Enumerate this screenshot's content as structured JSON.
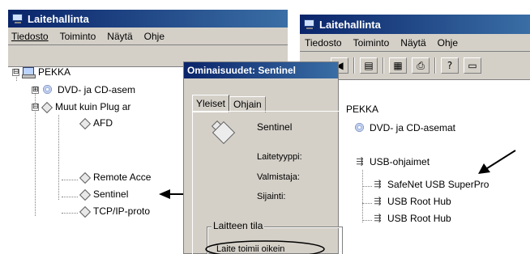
{
  "left_window": {
    "title": "Laitehallinta",
    "menu": [
      "Tiedosto",
      "Toiminto",
      "Näytä",
      "Ohje"
    ],
    "tree": {
      "root": "PEKKA",
      "items": [
        "DVD- ja CD-asem",
        "Muut kuin Plug ar",
        "AFD",
        "Remote Acce",
        "Sentinel",
        "TCP/IP-proto"
      ],
      "expanders": [
        "⊟",
        "⊞",
        "⊟"
      ]
    }
  },
  "dialog": {
    "title": "Ominaisuudet: Sentinel",
    "tabs": [
      "Yleiset",
      "Ohjain"
    ],
    "device_name": "Sentinel",
    "labels": [
      "Laitetyyppi:",
      "Valmistaja:",
      "Sijainti:"
    ],
    "group_label": "Laitteen tila",
    "status_text": "Laite toimii oikein"
  },
  "right_window": {
    "title": "Laitehallinta",
    "menu": [
      "Tiedosto",
      "Toiminto",
      "Näytä",
      "Ohje"
    ],
    "toolbar_icons": [
      "back-icon",
      "view-icon",
      "properties-icon",
      "print-icon",
      "help-icon"
    ],
    "tree": {
      "root": "PEKKA",
      "items": [
        "DVD- ja CD-asemat",
        "USB-ohjaimet",
        "SafeNet USB SuperPro",
        "USB Root Hub",
        "USB Root Hub"
      ]
    }
  },
  "colors": {
    "titlebar_start": "#0a246a",
    "titlebar_end": "#3a6ea5",
    "face": "#d4d0c8"
  }
}
